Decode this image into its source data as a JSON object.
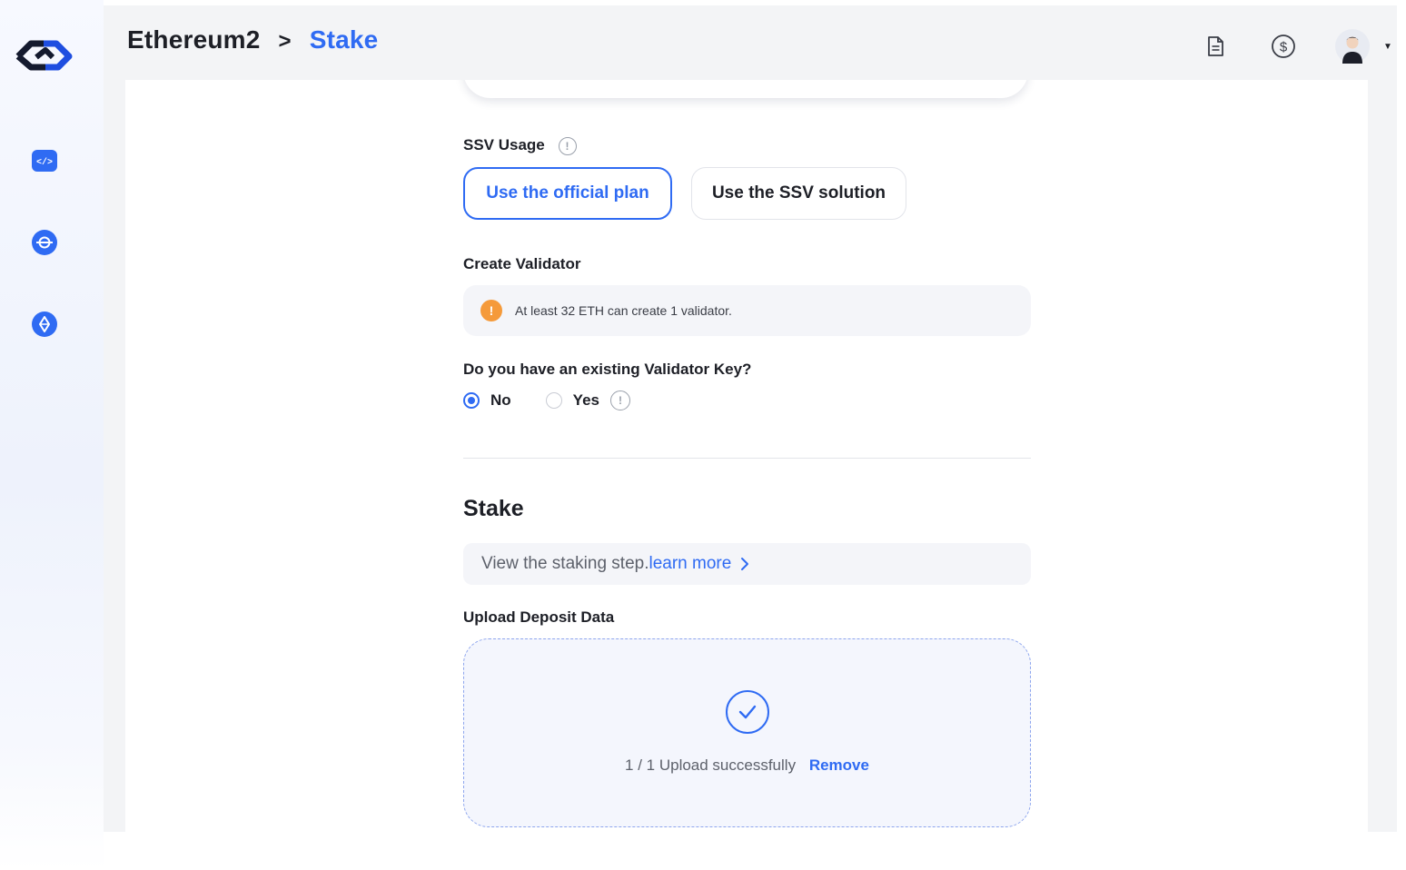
{
  "header": {
    "breadcrumb_root": "Ethereum2",
    "breadcrumb_separator": ">",
    "breadcrumb_current": "Stake",
    "icons": [
      "document-icon",
      "dollar-icon",
      "avatar"
    ]
  },
  "sidebar": {
    "items": [
      {
        "icon": "code-icon"
      },
      {
        "icon": "network-icon"
      },
      {
        "icon": "ethereum-icon"
      }
    ]
  },
  "ssv": {
    "label": "SSV Usage",
    "options": [
      {
        "label": "Use the official plan",
        "selected": true
      },
      {
        "label": "Use the SSV solution",
        "selected": false
      }
    ]
  },
  "validator": {
    "label": "Create Validator",
    "notice": "At least 32 ETH can create 1 validator.",
    "key_question": "Do you have an existing Validator Key?",
    "options": [
      {
        "label": "No",
        "checked": true
      },
      {
        "label": "Yes",
        "checked": false
      }
    ]
  },
  "stake": {
    "title": "Stake",
    "step_text": "View the staking step.",
    "learn_more": "learn more"
  },
  "upload": {
    "label": "Upload Deposit Data",
    "status": "1 / 1 Upload successfully",
    "remove_label": "Remove"
  },
  "colors": {
    "accent": "#2f6bf3",
    "warning": "#f59a3a",
    "page_bg": "#f3f4f6"
  }
}
